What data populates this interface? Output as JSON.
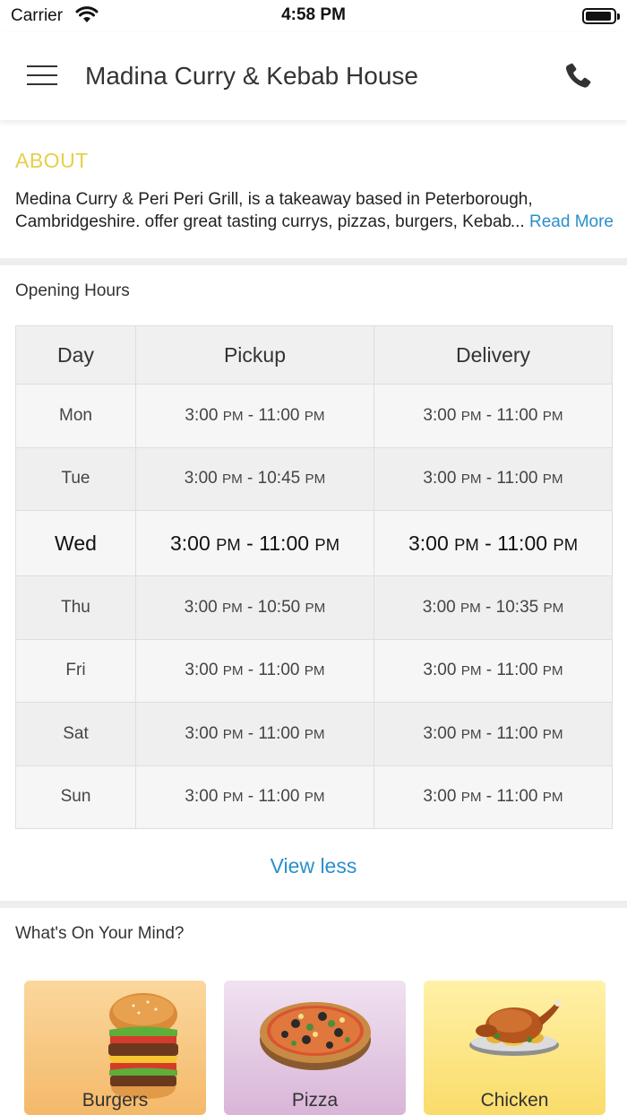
{
  "status_bar": {
    "carrier": "Carrier",
    "time": "4:58 PM"
  },
  "navbar": {
    "title": "Madina Curry & Kebab House",
    "menu_icon": "hamburger-menu-icon",
    "phone_icon": "phone-icon"
  },
  "about": {
    "heading": "ABOUT",
    "line1": "Medina Curry & Peri Peri Grill, is a takeaway based in Peterborough,",
    "line2": "Cambridgeshire. offer great tasting currys, pizzas, burgers, Kebab",
    "ellipsis": "...",
    "read_more": "Read More",
    "heading_color": "#e6cf4a",
    "link_color": "#2b8fcb"
  },
  "opening_hours": {
    "heading": "Opening Hours",
    "columns": [
      "Day",
      "Pickup",
      "Delivery"
    ],
    "rows": [
      {
        "day": "Mon",
        "pickup_open": "3:00",
        "pickup_close": "11:00",
        "delivery_open": "3:00",
        "delivery_close": "11:00"
      },
      {
        "day": "Tue",
        "pickup_open": "3:00",
        "pickup_close": "10:45",
        "delivery_open": "3:00",
        "delivery_close": "11:00"
      },
      {
        "day": "Wed",
        "pickup_open": "3:00",
        "pickup_close": "11:00",
        "delivery_open": "3:00",
        "delivery_close": "11:00"
      },
      {
        "day": "Thu",
        "pickup_open": "3:00",
        "pickup_close": "10:50",
        "delivery_open": "3:00",
        "delivery_close": "10:35"
      },
      {
        "day": "Fri",
        "pickup_open": "3:00",
        "pickup_close": "11:00",
        "delivery_open": "3:00",
        "delivery_close": "11:00"
      },
      {
        "day": "Sat",
        "pickup_open": "3:00",
        "pickup_close": "11:00",
        "delivery_open": "3:00",
        "delivery_close": "11:00"
      },
      {
        "day": "Sun",
        "pickup_open": "3:00",
        "pickup_close": "11:00",
        "delivery_open": "3:00",
        "delivery_close": "11:00"
      }
    ],
    "meridiem": "PM",
    "separator": "-",
    "today": "Wed",
    "view_less": "View less"
  },
  "whats_on_your_mind": {
    "heading": "What's On Your Mind?",
    "categories": [
      {
        "label": "Burgers",
        "icon": "burger-icon"
      },
      {
        "label": "Pizza",
        "icon": "pizza-icon"
      },
      {
        "label": "Chicken",
        "icon": "roast-chicken-icon"
      }
    ]
  }
}
